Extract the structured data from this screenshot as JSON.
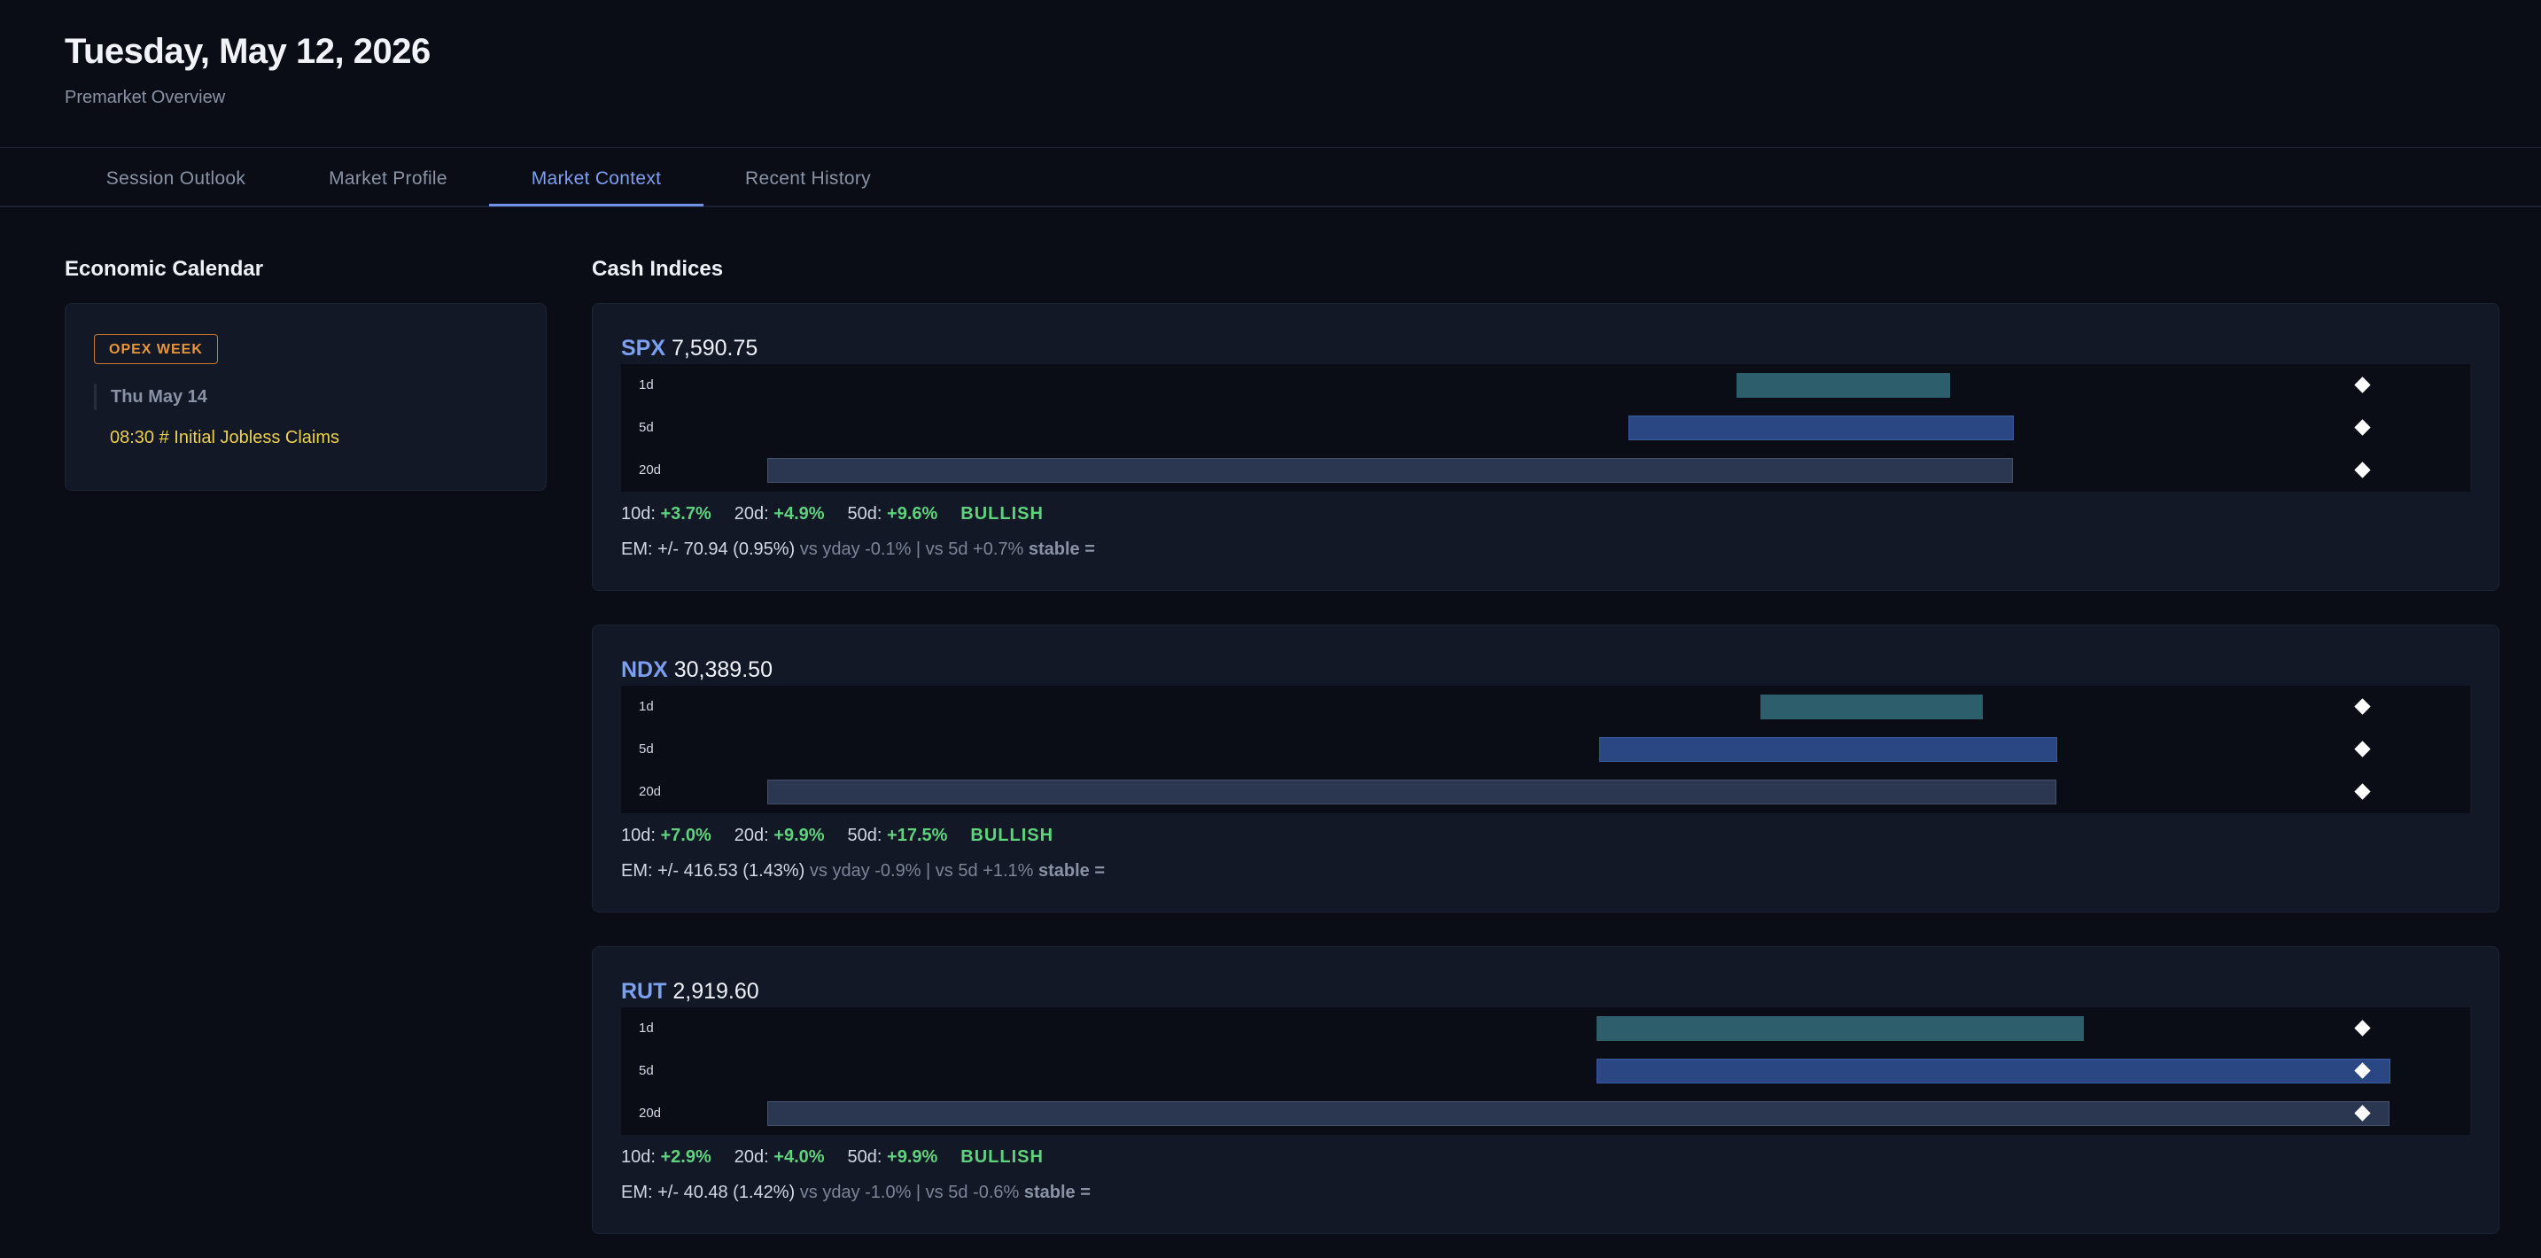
{
  "header": {
    "title": "Tuesday, May 12, 2026",
    "subtitle": "Premarket Overview"
  },
  "tabs": [
    {
      "label": "Session Outlook",
      "active": false
    },
    {
      "label": "Market Profile",
      "active": false
    },
    {
      "label": "Market Context",
      "active": true
    },
    {
      "label": "Recent History",
      "active": false
    }
  ],
  "calendar": {
    "title": "Economic Calendar",
    "badge": "OPEX WEEK",
    "date": "Thu May 14",
    "event": "08:30 # Initial Jobless Claims"
  },
  "indices_title": "Cash Indices",
  "indices": [
    {
      "symbol": "SPX",
      "price": "7,590.75",
      "ranges": [
        {
          "label": "1d",
          "start": 0.6031,
          "end": 0.7187
        },
        {
          "label": "5d",
          "start": 0.5447,
          "end": 0.7531
        },
        {
          "label": "20d",
          "start": 0.0793,
          "end": 0.7531
        }
      ],
      "marker": 0.9415,
      "stats": {
        "d10_label": "10d:",
        "d10": "+3.7%",
        "d20_label": "20d:",
        "d20": "+4.9%",
        "d50_label": "50d:",
        "d50": "+9.6%",
        "trend": "BULLISH"
      },
      "em": {
        "main": "EM: +/- 70.94 (0.95%)",
        "compare": "vs yday -0.1% | vs 5d +0.7%",
        "status": "stable ="
      }
    },
    {
      "symbol": "NDX",
      "price": "30,389.50",
      "ranges": [
        {
          "label": "1d",
          "start": 0.6161,
          "end": 0.7364
        },
        {
          "label": "5d",
          "start": 0.5289,
          "end": 0.7767
        },
        {
          "label": "20d",
          "start": 0.0793,
          "end": 0.7767
        }
      ],
      "marker": 0.9415,
      "stats": {
        "d10_label": "10d:",
        "d10": "+7.0%",
        "d20_label": "20d:",
        "d20": "+9.9%",
        "d50_label": "50d:",
        "d50": "+17.5%",
        "trend": "BULLISH"
      },
      "em": {
        "main": "EM: +/- 416.53 (1.43%)",
        "compare": "vs yday -0.9% | vs 5d +1.1%",
        "status": "stable ="
      }
    },
    {
      "symbol": "RUT",
      "price": "2,919.60",
      "ranges": [
        {
          "label": "1d",
          "start": 0.5274,
          "end": 0.791
        },
        {
          "label": "5d",
          "start": 0.5274,
          "end": 0.9568
        },
        {
          "label": "20d",
          "start": 0.0793,
          "end": 0.9568
        }
      ],
      "marker": 0.9415,
      "stats": {
        "d10_label": "10d:",
        "d10": "+2.9%",
        "d20_label": "20d:",
        "d20": "+4.0%",
        "d50_label": "50d:",
        "d50": "+9.9%",
        "trend": "BULLISH"
      },
      "em": {
        "main": "EM: +/- 40.48 (1.42%)",
        "compare": "vs yday -1.0% | vs 5d -0.6%",
        "status": "stable ="
      }
    }
  ]
}
